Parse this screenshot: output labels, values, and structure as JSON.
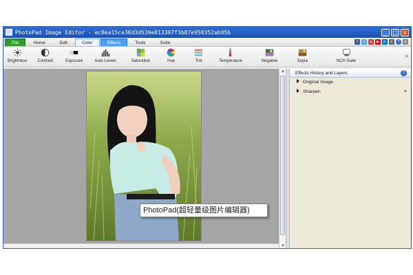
{
  "window": {
    "title": "PhotoPad Image Editor - ec8ea15ce36d3d539e013397f3b87e950352ab05b"
  },
  "menu": {
    "tabs": [
      {
        "label": "File"
      },
      {
        "label": "Home"
      },
      {
        "label": "Edit"
      },
      {
        "label": "Color"
      },
      {
        "label": "Effects"
      },
      {
        "label": "Tools"
      },
      {
        "label": "Suite"
      }
    ],
    "active_tab": "Color",
    "help_label": "?"
  },
  "toolbar": {
    "tools": [
      {
        "label": "Brightness",
        "icon": "brightness-icon"
      },
      {
        "label": "Contrast",
        "icon": "contrast-icon"
      },
      {
        "label": "Exposure",
        "icon": "exposure-icon"
      },
      {
        "label": "Auto Levels",
        "icon": "levels-icon"
      },
      {
        "label": "Saturation",
        "icon": "saturation-icon"
      },
      {
        "label": "Hue",
        "icon": "hue-icon"
      },
      {
        "label": "Tint",
        "icon": "tint-icon"
      },
      {
        "label": "Temperature",
        "icon": "thermometer-icon"
      },
      {
        "label": "Negative",
        "icon": "negative-icon"
      },
      {
        "label": "Sepia",
        "icon": "sepia-icon"
      },
      {
        "label": "NCH Suite",
        "icon": "nch-suite-icon"
      }
    ],
    "more": "»"
  },
  "panel": {
    "title": "Effects History and Layers",
    "help": "?",
    "layers": [
      {
        "label": "Original Image",
        "removable": false
      },
      {
        "label": "Sharpen",
        "removable": true
      }
    ],
    "remove_symbol": "×"
  },
  "tooltip": {
    "text": "PhotoPad(超轻量级图片编辑器)"
  },
  "colors": {
    "title_bar": "#1c4fb0",
    "file_tab": "#2f9d2f",
    "effects_tab": "#4c9ef2",
    "canvas": "#a6a6a6",
    "panel": "#ece9d8"
  }
}
